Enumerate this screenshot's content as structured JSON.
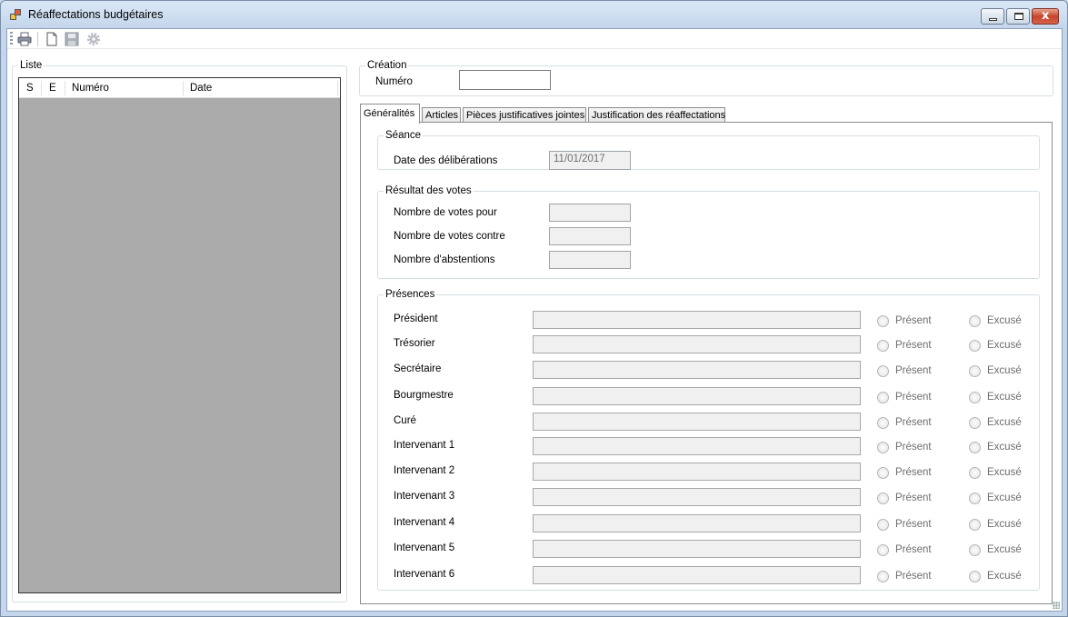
{
  "window": {
    "title": "Réaffectations budgétaires"
  },
  "toolbar": {
    "buttons": [
      {
        "icon": "printer-icon"
      },
      {
        "icon": "new-document-icon"
      },
      {
        "icon": "save-icon"
      },
      {
        "icon": "settings-gear-icon"
      }
    ]
  },
  "liste": {
    "legend": "Liste",
    "columns": [
      "S",
      "E",
      "Numéro",
      "Date"
    ]
  },
  "creation": {
    "legend": "Création",
    "numero_label": "Numéro",
    "numero_value": ""
  },
  "tabs": [
    "Généralités",
    "Articles",
    "Pièces justificatives jointes",
    "Justification des réaffectations"
  ],
  "seance": {
    "legend": "Séance",
    "date_label": "Date des délibérations",
    "date_value": "11/01/2017"
  },
  "votes": {
    "legend": "Résultat des votes",
    "pour_label": "Nombre de votes pour",
    "pour_value": "",
    "contre_label": "Nombre de votes contre",
    "contre_value": "",
    "abstentions_label": "Nombre d'abstentions",
    "abstentions_value": ""
  },
  "presences": {
    "legend": "Présences",
    "option_present": "Présent",
    "option_excuse": "Excusé",
    "rows": [
      "Président",
      "Trésorier",
      "Secrétaire",
      "Bourgmestre",
      "Curé",
      "Intervenant 1",
      "Intervenant 2",
      "Intervenant 3",
      "Intervenant 4",
      "Intervenant 5",
      "Intervenant 6"
    ]
  }
}
